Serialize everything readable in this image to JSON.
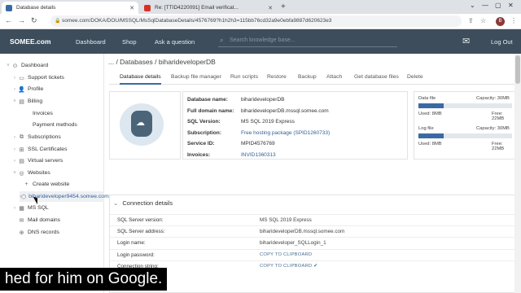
{
  "browser": {
    "tabs": [
      {
        "title": "Database details",
        "favicon_color": "#3a6aa3"
      },
      {
        "title": "Re: [TTID4220091] Email verificat...",
        "favicon_color": "#d93025"
      }
    ],
    "new_tab": "+",
    "url": "somee.com/DOKA/DOU/MSSQL/MsSqlDatabaseDetails/4576769?h1h2h3=115bb76cd32a9e0ebfa9887d620623e3",
    "profile_initial": "B"
  },
  "topnav": {
    "brand": "SOMEE.com",
    "links": [
      "Dashboard",
      "Shop",
      "Ask a question"
    ],
    "search_placeholder": "Search knowledge base...",
    "logout": "Log Out"
  },
  "sidebar": {
    "items": [
      {
        "label": "Dashboard",
        "arrow": "˅",
        "icon": "⊙",
        "indent": 0
      },
      {
        "label": "Support tickets",
        "arrow": "›",
        "icon": "▭",
        "indent": 1
      },
      {
        "label": "Profile",
        "arrow": "›",
        "icon": "👤",
        "indent": 1
      },
      {
        "label": "Billing",
        "arrow": "˅",
        "icon": "▤",
        "indent": 1
      },
      {
        "label": "Invoices",
        "arrow": "",
        "icon": "",
        "indent": 2
      },
      {
        "label": "Payment methods",
        "arrow": "",
        "icon": "",
        "indent": 2
      },
      {
        "label": "Subscriptions",
        "arrow": "›",
        "icon": "⧉",
        "indent": 1
      },
      {
        "label": "SSL Certificates",
        "arrow": "›",
        "icon": "⊞",
        "indent": 1
      },
      {
        "label": "Virtual servers",
        "arrow": "›",
        "icon": "▤",
        "indent": 1
      },
      {
        "label": "Websites",
        "arrow": "˅",
        "icon": "◎",
        "indent": 1
      },
      {
        "label": "Create website",
        "arrow": "",
        "icon": "+",
        "indent": 2
      },
      {
        "label": "biharideveloper9454.somee.com",
        "arrow": "›",
        "icon": "⬡",
        "indent": 2
      },
      {
        "label": "MS SQL",
        "arrow": "›",
        "icon": "▦",
        "indent": 1
      },
      {
        "label": "Mail domains",
        "arrow": "",
        "icon": "✉",
        "indent": 1
      },
      {
        "label": "DNS records",
        "arrow": "",
        "icon": "⊕",
        "indent": 1
      }
    ]
  },
  "main": {
    "breadcrumb": "... / Databases / biharideveloperDB",
    "tabs": [
      "Database details",
      "Backup file manager",
      "Run scripts",
      "Restore",
      "Backup",
      "Attach",
      "Get database files",
      "Delete"
    ],
    "info": [
      {
        "key": "Database name:",
        "value": "biharideveloperDB",
        "link": false
      },
      {
        "key": "Full domain name:",
        "value": "biharideveloperDB.mssql.somee.com",
        "link": false
      },
      {
        "key": "SQL Version:",
        "value": "MS SQL 2019 Express",
        "link": false
      },
      {
        "key": "Subscription:",
        "value": "Free hosting package (SPID1260733)",
        "link": true
      },
      {
        "key": "Service ID:",
        "value": "MPID4576769",
        "link": false
      },
      {
        "key": "Invoices:",
        "value": "INVID1360313",
        "link": true
      }
    ],
    "usage": {
      "data": {
        "title": "Data file",
        "capacity": "Capacity: 30MB",
        "used": "Used: 8MB",
        "free": "Free: 22MB",
        "fraction": 0.267
      },
      "log": {
        "title": "Log file",
        "capacity": "Capacity: 30MB",
        "used": "Used: 8MB",
        "free": "Free: 22MB",
        "fraction": 0.267
      }
    },
    "connection": {
      "title": "Connection details",
      "rows": [
        {
          "key": "SQL Server version:",
          "value": "MS SQL 2019 Express",
          "copy": false
        },
        {
          "key": "SQL Server address:",
          "value": "biharideveloperDB.mssql.somee.com",
          "copy": false
        },
        {
          "key": "Login name:",
          "value": "biharideveloper_SQLLogin_1",
          "copy": false
        },
        {
          "key": "Login password:",
          "value": "COPY TO CLIPBOARD",
          "copy": true
        },
        {
          "key": "Connection string:",
          "value": "COPY TO CLIPBOARD ✔",
          "copy": true
        }
      ]
    }
  },
  "caption": "hed for him on Google."
}
